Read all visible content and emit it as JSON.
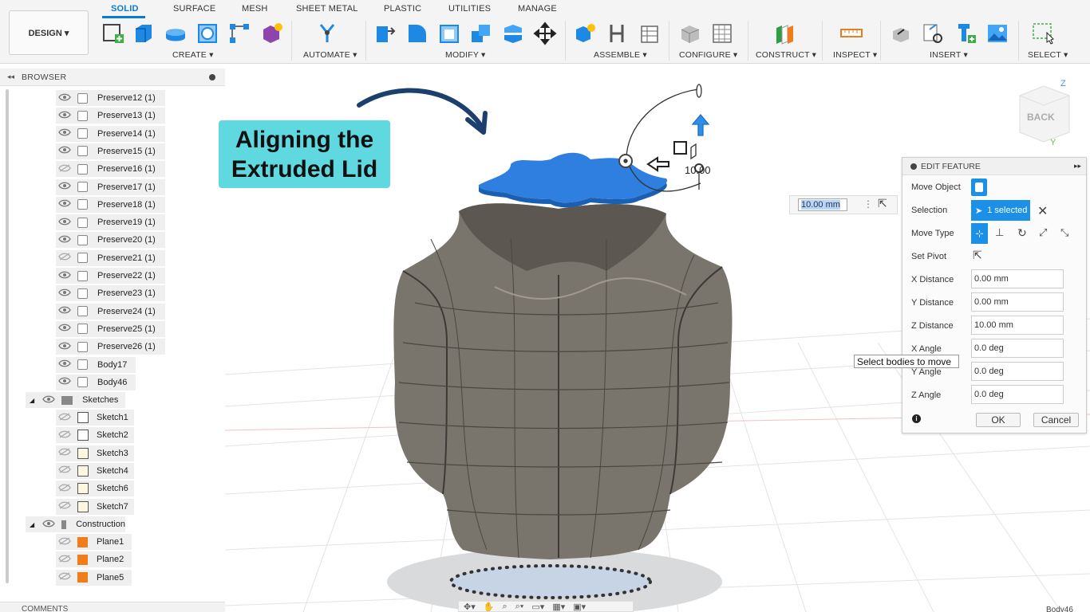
{
  "toolbar": {
    "design_label": "DESIGN ▾",
    "tabs": [
      "SOLID",
      "SURFACE",
      "MESH",
      "SHEET METAL",
      "PLASTIC",
      "UTILITIES",
      "MANAGE"
    ],
    "groups": [
      "CREATE ▾",
      "AUTOMATE ▾",
      "MODIFY ▾",
      "ASSEMBLE ▾",
      "CONFIGURE ▾",
      "CONSTRUCT ▾",
      "INSPECT ▾",
      "INSERT ▾",
      "SELECT ▾"
    ]
  },
  "browser": {
    "title": "BROWSER",
    "bodies": [
      "Preserve12 (1)",
      "Preserve13 (1)",
      "Preserve14 (1)",
      "Preserve15 (1)",
      "Preserve16 (1)",
      "Preserve17 (1)",
      "Preserve18 (1)",
      "Preserve19 (1)",
      "Preserve20 (1)",
      "Preserve21 (1)",
      "Preserve22 (1)",
      "Preserve23 (1)",
      "Preserve24 (1)",
      "Preserve25 (1)",
      "Preserve26 (1)",
      "Body17",
      "Body46"
    ],
    "sketches_folder": "Sketches",
    "sketches": [
      "Sketch1",
      "Sketch2",
      "Sketch3",
      "Sketch4",
      "Sketch6",
      "Sketch7"
    ],
    "construction_folder": "Construction",
    "planes": [
      "Plane1",
      "Plane2",
      "Plane5"
    ],
    "comments_label": "COMMENTS"
  },
  "callout": {
    "line1": "Aligning the",
    "line2": "Extruded Lid"
  },
  "viewcube": {
    "face": "BACK",
    "axis_z": "Z",
    "axis_y": "Y"
  },
  "manipulator": {
    "value_label": "10.00"
  },
  "distance_box": {
    "value": "10.00 mm"
  },
  "edit_feature": {
    "title": "EDIT FEATURE",
    "move_object_label": "Move Object",
    "selection_label": "Selection",
    "selection_value": "1 selected",
    "move_type_label": "Move Type",
    "set_pivot_label": "Set Pivot",
    "fields": [
      {
        "label": "X Distance",
        "value": "0.00 mm"
      },
      {
        "label": "Y Distance",
        "value": "0.00 mm"
      },
      {
        "label": "Z Distance",
        "value": "10.00 mm"
      },
      {
        "label": "X Angle",
        "value": "0.0 deg"
      },
      {
        "label": "Y Angle",
        "value": "0.0 deg"
      },
      {
        "label": "Z Angle",
        "value": "0.0 deg"
      }
    ],
    "ok_label": "OK",
    "cancel_label": "Cancel"
  },
  "tooltip": "Select bodies to move",
  "status_right": "Body46",
  "colors": {
    "accent": "#0a7bd4",
    "callout": "#5fd8df",
    "lid": "#2f7fe0",
    "vase": "#77726a"
  }
}
